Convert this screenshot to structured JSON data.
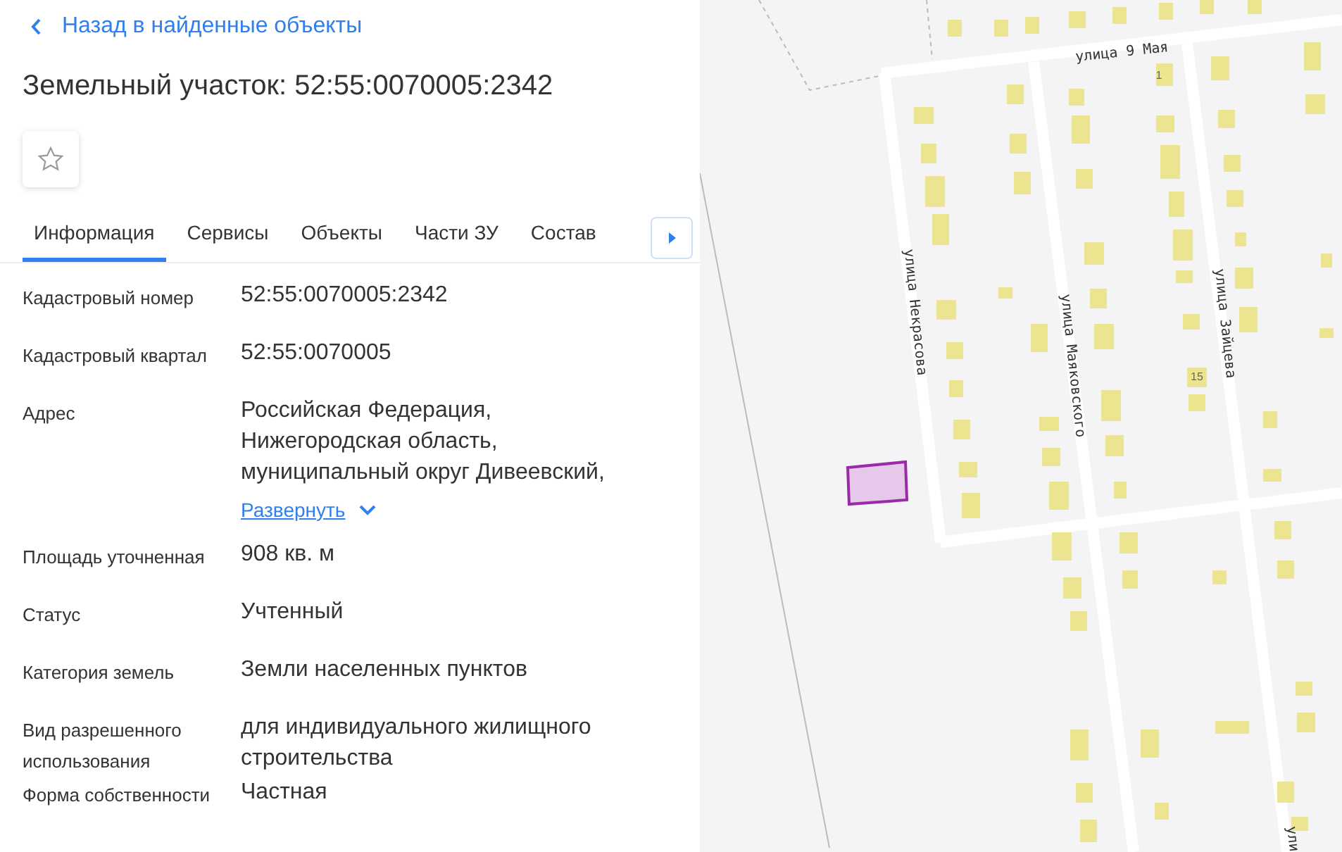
{
  "back_link": {
    "label": "Назад в найденные объекты"
  },
  "title": "Земельный участок: 52:55:0070005:2342",
  "favorite": {
    "selected": false
  },
  "tabs": [
    {
      "label": "Информация",
      "selected": true
    },
    {
      "label": "Сервисы",
      "selected": false
    },
    {
      "label": "Объекты",
      "selected": false
    },
    {
      "label": "Части ЗУ",
      "selected": false
    },
    {
      "label": "Состав",
      "selected": false
    }
  ],
  "fields": [
    {
      "label": "Кадастровый номер",
      "value": [
        "52:55:0070005:2342"
      ]
    },
    {
      "label": "Кадастровый квартал",
      "value": [
        "52:55:0070005"
      ]
    },
    {
      "label": "Адрес",
      "value": [
        "Российская Федерация,",
        "Нижегородская область,",
        "муниципальный округ Дивеевский,"
      ],
      "expand_link": "Развернуть"
    },
    {
      "label": "Площадь уточненная",
      "value": [
        "908 кв. м"
      ]
    },
    {
      "label": "Статус",
      "value": [
        "Учтенный"
      ]
    },
    {
      "label": "Категория земель",
      "value": [
        "Земли населенных пунктов"
      ]
    },
    {
      "label": "Вид разрешенного использования",
      "value": [
        "для индивидуального жилищного строительства"
      ]
    },
    {
      "label": "Форма собственности",
      "value": [
        "Частная"
      ]
    }
  ],
  "map": {
    "street_labels": [
      "улица 9 Мая",
      "улица Некрасова",
      "улица Маяковского",
      "улица Зайцева",
      "ули"
    ],
    "house_numbers": [
      "1",
      "15"
    ]
  }
}
